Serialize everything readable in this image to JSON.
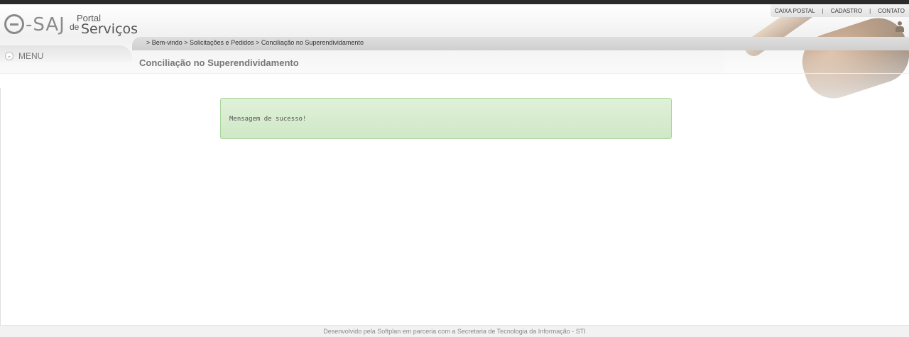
{
  "logo": {
    "e_saj": "-SAJ",
    "portal": "Portal",
    "de": "de",
    "servicos": "Serviços"
  },
  "toplinks": {
    "caixa_postal": "CAIXA POSTAL",
    "separator": "|",
    "cadastro": "CADASTRO",
    "contato": "CONTATO"
  },
  "menu": {
    "label": "MENU",
    "chevron": "⌄"
  },
  "breadcrumb": {
    "items": [
      "> Bem-vindo",
      " > Solicitações e Pedidos",
      " > Conciliação no Superendividamento"
    ]
  },
  "page": {
    "title": "Conciliação no Superendividamento"
  },
  "alert": {
    "message": "Mensagem de sucesso!",
    "status_color": "#dff0d8"
  },
  "footer": {
    "text": "Desenvolvido pela Softplan em parceria com a Secretaria de Tecnologia da Informação - STI"
  },
  "icons": [
    "gavel-image",
    "user-icon",
    "chevron-down-icon"
  ]
}
